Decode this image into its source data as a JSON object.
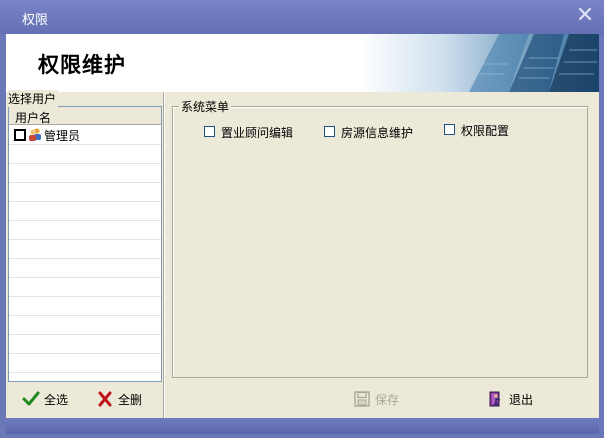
{
  "window": {
    "title": "权限"
  },
  "banner": {
    "title": "权限维护"
  },
  "users": {
    "group_label": "选择用户",
    "column_header": "用户名",
    "rows": [
      {
        "name": "管理员",
        "checked": false
      }
    ]
  },
  "menu": {
    "group_label": "系统菜单",
    "items": [
      {
        "label": "置业顾问编辑",
        "checked": false
      },
      {
        "label": "房源信息维护",
        "checked": false
      },
      {
        "label": "权限配置",
        "checked": false
      }
    ]
  },
  "buttons": {
    "select_all": "全选",
    "delete_all": "全删",
    "save": "保存",
    "exit": "退出"
  },
  "colors": {
    "titlebar": "#6b78b8",
    "panel": "#ece9d8",
    "accent_check": "#1f8a1f",
    "accent_cross": "#c0141c"
  }
}
